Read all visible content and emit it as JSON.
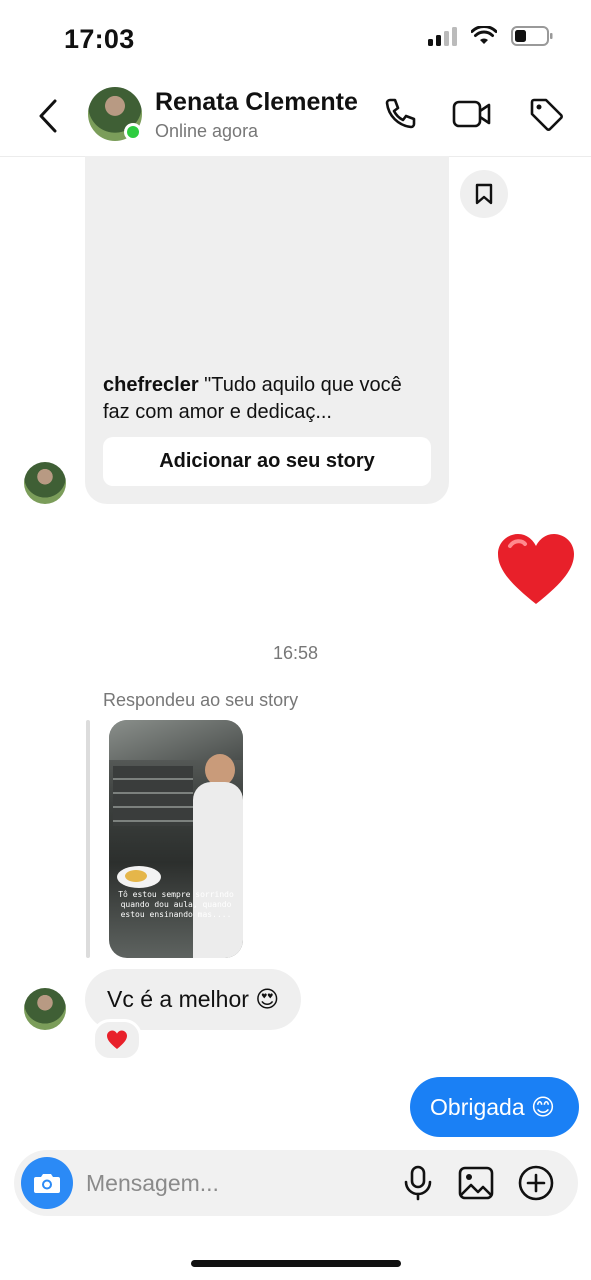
{
  "status_bar": {
    "time": "17:03"
  },
  "header": {
    "contact_name": "Renata Clemente",
    "contact_status": "Online agora",
    "icons": [
      "back-arrow-icon",
      "phone-icon",
      "video-camera-icon",
      "tag-icon"
    ]
  },
  "shared_story": {
    "username": "chefrecler",
    "caption": " \"Tudo aquilo que você faz com amor e dedicaç...",
    "add_button_label": "Adicionar ao seu story",
    "save_icon": "bookmark-icon"
  },
  "sent_reaction": "heart-emoji",
  "timestamp": "16:58",
  "story_reply": {
    "label": "Respondeu ao seu story",
    "thumbnail_text": "Tô estou sempre sorrindo quando dou aula, quando estou ensinando mas....",
    "message": "Vc é a melhor 😍",
    "reaction": "❤️"
  },
  "outgoing_message": "Obrigada 😊",
  "composer": {
    "placeholder": "Mensagem...",
    "icons": [
      "camera-icon",
      "microphone-icon",
      "image-icon",
      "plus-circle-icon"
    ]
  },
  "colors": {
    "accent": "#1a80f5",
    "bubble_in": "#efefef",
    "online": "#2ecc40",
    "heart": "#e8202a"
  }
}
